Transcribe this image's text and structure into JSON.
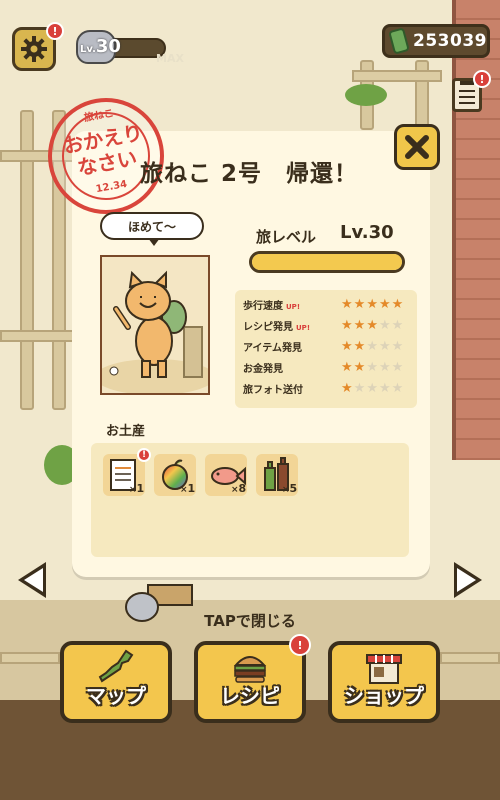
{
  "hud": {
    "settings_badge": "!",
    "level_prefix": "Lv.",
    "level_value": "30",
    "level_max": "MAX",
    "money": "253039",
    "clipboard_badge": "!"
  },
  "stamp": {
    "top_text": "おかえり",
    "mid_text": "なさい",
    "date": "12.34",
    "small_top": "旅ねこ"
  },
  "modal": {
    "title": "旅ねこ 2号　帰還！",
    "speech": "ほめて〜",
    "travel_level_label": "旅レベル",
    "travel_level_value": "Lv.30",
    "travel_level_progress": 1.0,
    "stats": [
      {
        "name": "歩行速度",
        "up": "UP!",
        "stars": 5
      },
      {
        "name": "レシピ発見",
        "up": "UP!",
        "stars": 3
      },
      {
        "name": "アイテム発見",
        "up": "",
        "stars": 2
      },
      {
        "name": "お金発見",
        "up": "",
        "stars": 2
      },
      {
        "name": "旅フォト送付",
        "up": "",
        "stars": 1
      }
    ],
    "souvenir_title": "お土産",
    "souvenirs": [
      {
        "icon": "notebook-icon",
        "count": "1",
        "badge": "!"
      },
      {
        "icon": "rainbow-apple-icon",
        "count": "1"
      },
      {
        "icon": "fish-icon",
        "count": "8"
      },
      {
        "icon": "bottles-icon",
        "count": "5"
      }
    ]
  },
  "tap_to_close": "TAPで閉じる",
  "nav": {
    "map_label": "マップ",
    "recipe_label": "レシピ",
    "recipe_badge": "!",
    "shop_label": "ショップ"
  },
  "colors": {
    "accent": "#f3c64d",
    "outline": "#3a2e1c",
    "stamp_red": "#d9453b",
    "star_on": "#e48a2a",
    "star_off": "#ddd3b8",
    "badge_red": "#d9403b"
  }
}
